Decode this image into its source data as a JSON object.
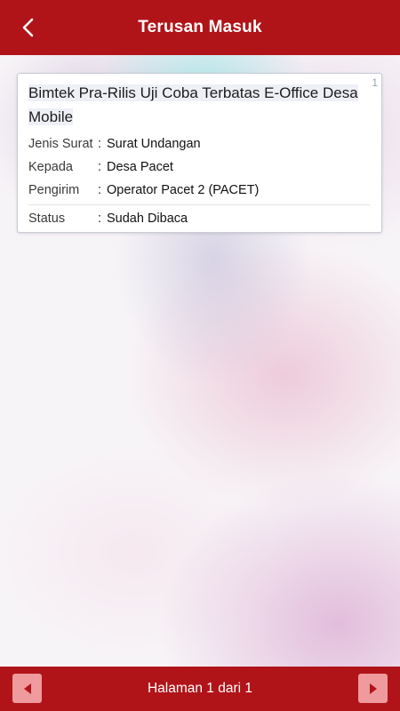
{
  "header": {
    "title": "Terusan Masuk",
    "back_icon": "chevron-left-icon"
  },
  "cards": [
    {
      "index": "1",
      "title": "Bimtek Pra-Rilis Uji Coba Terbatas E-Office Desa Mobile",
      "fields": [
        {
          "label": "Jenis Surat",
          "value": "Surat Undangan"
        },
        {
          "label": "Kepada",
          "value": "Desa Pacet"
        },
        {
          "label": "Pengirim",
          "value": "Operator Pacet 2 (PACET)"
        }
      ],
      "status_label": "Status",
      "status_value": "Sudah Dibaca",
      "separator": ":"
    }
  ],
  "footer": {
    "page_text": "Halaman 1 dari 1",
    "prev_icon": "triangle-left-icon",
    "next_icon": "triangle-right-icon"
  },
  "colors": {
    "brand_red": "#b01419",
    "button_pink": "#ef9a9c",
    "status_green": "#17c047"
  }
}
